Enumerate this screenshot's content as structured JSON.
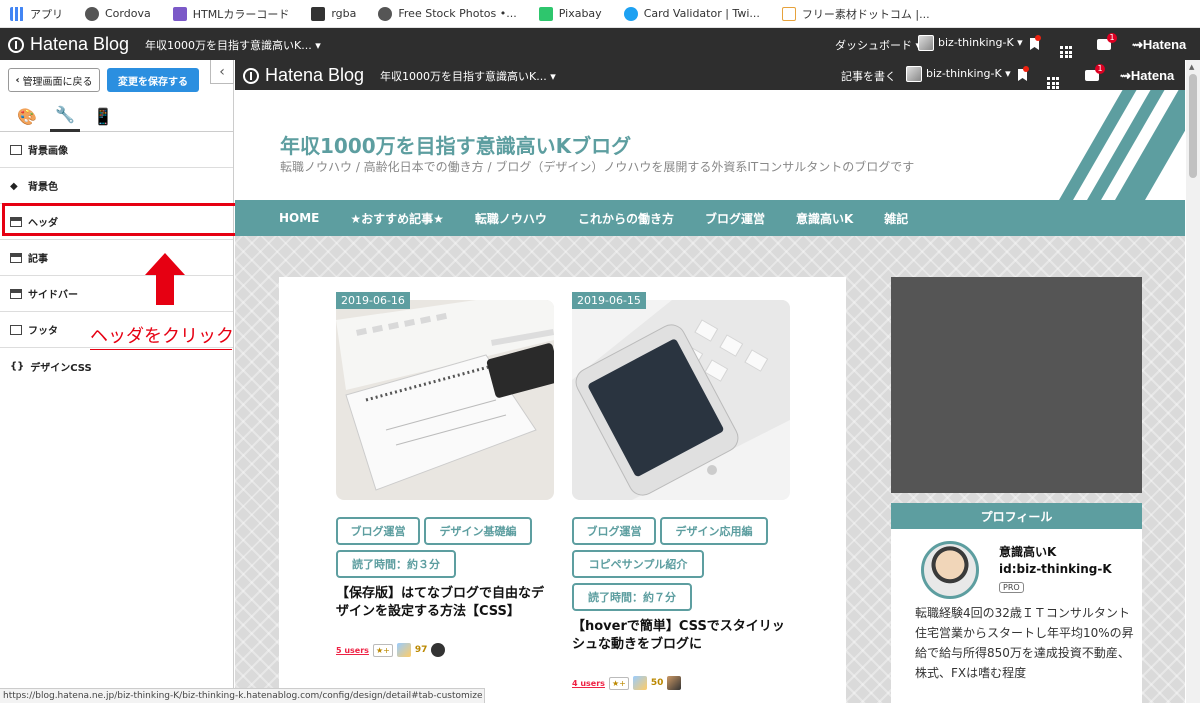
{
  "bookmarks": [
    {
      "label": "アプリ",
      "color": "#4285f4"
    },
    {
      "label": "Cordova",
      "color": "#555555"
    },
    {
      "label": "HTMLカラーコード",
      "color": "#7b59c8"
    },
    {
      "label": "rgba",
      "color": "#333333"
    },
    {
      "label": "Free Stock Photos •...",
      "color": "#555555"
    },
    {
      "label": "Pixabay",
      "color": "#2ec66d"
    },
    {
      "label": "Card Validator | Twi...",
      "color": "#1da1f2"
    },
    {
      "label": "フリー素材ドットコム |...",
      "color": "#e6a23c"
    }
  ],
  "topbar": {
    "logo": "Hatena Blog",
    "blog_title": "年収1000万を目指す意識高いK... ▾",
    "dashboard": "ダッシュボード ▾",
    "user": "biz-thinking-K ▾",
    "notif_count": "1",
    "hatena": "Hatena"
  },
  "sidebar": {
    "back": "管理画面に戻る",
    "save": "変更を保存する",
    "collapse": "‹",
    "tabs": [
      "design-palette",
      "customize-wrench",
      "smartphone"
    ],
    "items": [
      {
        "label": "背景画像"
      },
      {
        "label": "背景色"
      },
      {
        "label": "ヘッダ"
      },
      {
        "label": "記事"
      },
      {
        "label": "サイドバー"
      },
      {
        "label": "フッタ"
      },
      {
        "label": "デザインCSS",
        "icon_text": "{}"
      }
    ],
    "callout": "ヘッダをクリック",
    "highlight_color": "#e60012"
  },
  "preview": {
    "bar": {
      "logo": "Hatena Blog",
      "blog_title": "年収1000万を目指す意識高いK... ▾",
      "write": "記事を書く",
      "user": "biz-thinking-K ▾",
      "notif_count": "1",
      "hatena": "Hatena"
    },
    "site_title": "年収1000万を目指す意識高いKブログ",
    "site_desc": "転職ノウハウ / 高齢化日本での働き方 / ブログ（デザイン）ノウハウを展開する外資系ITコンサルタントのブログです",
    "accent": "#5d9ea0",
    "nav": [
      "HOME",
      "★おすすめ記事★",
      "転職ノウハウ",
      "これからの働き方",
      "ブログ運営",
      "意識高いK",
      "雑記"
    ],
    "cards": [
      {
        "date": "2019-06-16",
        "tags": [
          "ブログ運営",
          "デザイン基礎編",
          "読了時間：約３分"
        ],
        "title": "【保存版】はてなブログで自由なデザインを設定する方法【CSS】",
        "users": "5 users",
        "star": "★+",
        "count": "97"
      },
      {
        "date": "2019-06-15",
        "tags": [
          "ブログ運営",
          "デザイン応用編",
          "コピペサンプル紹介",
          "読了時間：約７分"
        ],
        "title": "【hoverで簡単】CSSでスタイリッシュな動きをブログに",
        "users": "4 users",
        "star": "★+",
        "count": "50"
      }
    ],
    "profile": {
      "heading": "プロフィール",
      "name": "意識高いK",
      "id": "id:biz-thinking-K",
      "pro": "PRO",
      "bio": "転職経験4回の32歳ＩＴコンサルタント住宅営業からスタートし年平均10%の昇給で給与所得850万を達成投資不動産、株式、FXは嗜む程度"
    }
  },
  "status_url": "https://blog.hatena.ne.jp/biz-thinking-K/biz-thinking-k.hatenablog.com/config/design/detail#tab-customize"
}
